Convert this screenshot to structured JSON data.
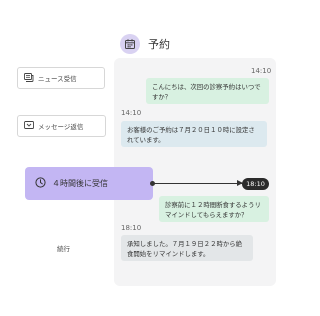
{
  "header": {
    "title": "予約",
    "icon": "calendar-icon"
  },
  "sidebar": {
    "buttons": [
      {
        "label": "ニュース受信",
        "icon": "news-icon"
      },
      {
        "label": "メッセージ返信",
        "icon": "reply-icon"
      }
    ],
    "trigger": {
      "label": "４時間後に受信",
      "icon": "clock-icon",
      "color": "#c3b6f3"
    },
    "other": "続行"
  },
  "chat": {
    "messages": [
      {
        "time": "14:10",
        "text": "こんにちは、次回の診察予約はいつですか？"
      },
      {
        "time": "14:10",
        "text": "お客様のご予約は７月２０日１０時に設定されています。"
      },
      {
        "time": "18:10",
        "text": "診察前に１２時間断食するようリマインドしてもらえますか？"
      },
      {
        "time": "18:10",
        "text": "承知しました。７月１９日２２時から絶食開始をリマインドします。"
      }
    ]
  },
  "colors": {
    "accent": "#c3b6f3",
    "panel": "#f4f4f5",
    "bubble_green": "#d8f1e1",
    "bubble_blue": "#dce9ef"
  }
}
